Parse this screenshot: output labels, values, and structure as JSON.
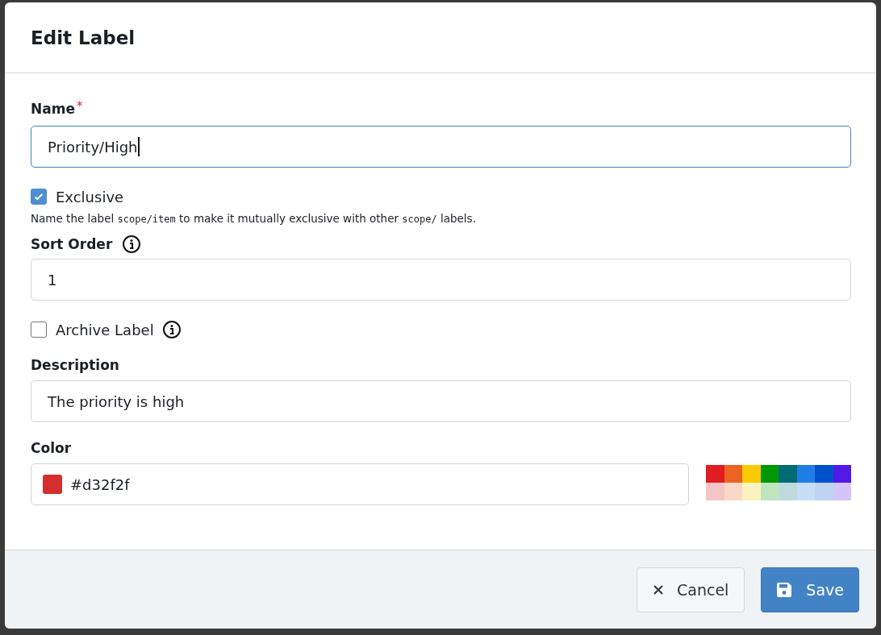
{
  "dialog": {
    "title": "Edit Label"
  },
  "name": {
    "label": "Name",
    "required_mark": "*",
    "value": "Priority/High"
  },
  "exclusive": {
    "label": "Exclusive",
    "checked": true
  },
  "help": [
    {
      "kind": "text",
      "text": "Name the label "
    },
    {
      "kind": "code",
      "text": "scope/item"
    },
    {
      "kind": "text",
      "text": " to make it mutually exclusive with other "
    },
    {
      "kind": "code",
      "text": "scope/"
    },
    {
      "kind": "text",
      "text": " labels."
    }
  ],
  "sort_order": {
    "label": "Sort Order",
    "value": "1"
  },
  "archive": {
    "label": "Archive Label",
    "checked": false
  },
  "description": {
    "label": "Description",
    "value": "The priority is high"
  },
  "color": {
    "label": "Color",
    "value": "#d32f2f"
  },
  "palette": [
    [
      {
        "color": "#e11d21"
      },
      {
        "color": "#eb6420"
      },
      {
        "color": "#fbca04"
      },
      {
        "color": "#009800"
      },
      {
        "color": "#006b75"
      },
      {
        "color": "#207de5"
      },
      {
        "color": "#0052cc"
      },
      {
        "color": "#5319e7"
      }
    ],
    [
      {
        "color": "#f6c6c7"
      },
      {
        "color": "#fad8c7"
      },
      {
        "color": "#fef2c0"
      },
      {
        "color": "#bfe5bf"
      },
      {
        "color": "#bfdadc"
      },
      {
        "color": "#c7def8"
      },
      {
        "color": "#bfd4f2"
      },
      {
        "color": "#d4c5f9"
      }
    ]
  ],
  "buttons": [
    {
      "kind": "cancel",
      "label": "Cancel"
    },
    {
      "kind": "save",
      "label": "Save"
    }
  ]
}
